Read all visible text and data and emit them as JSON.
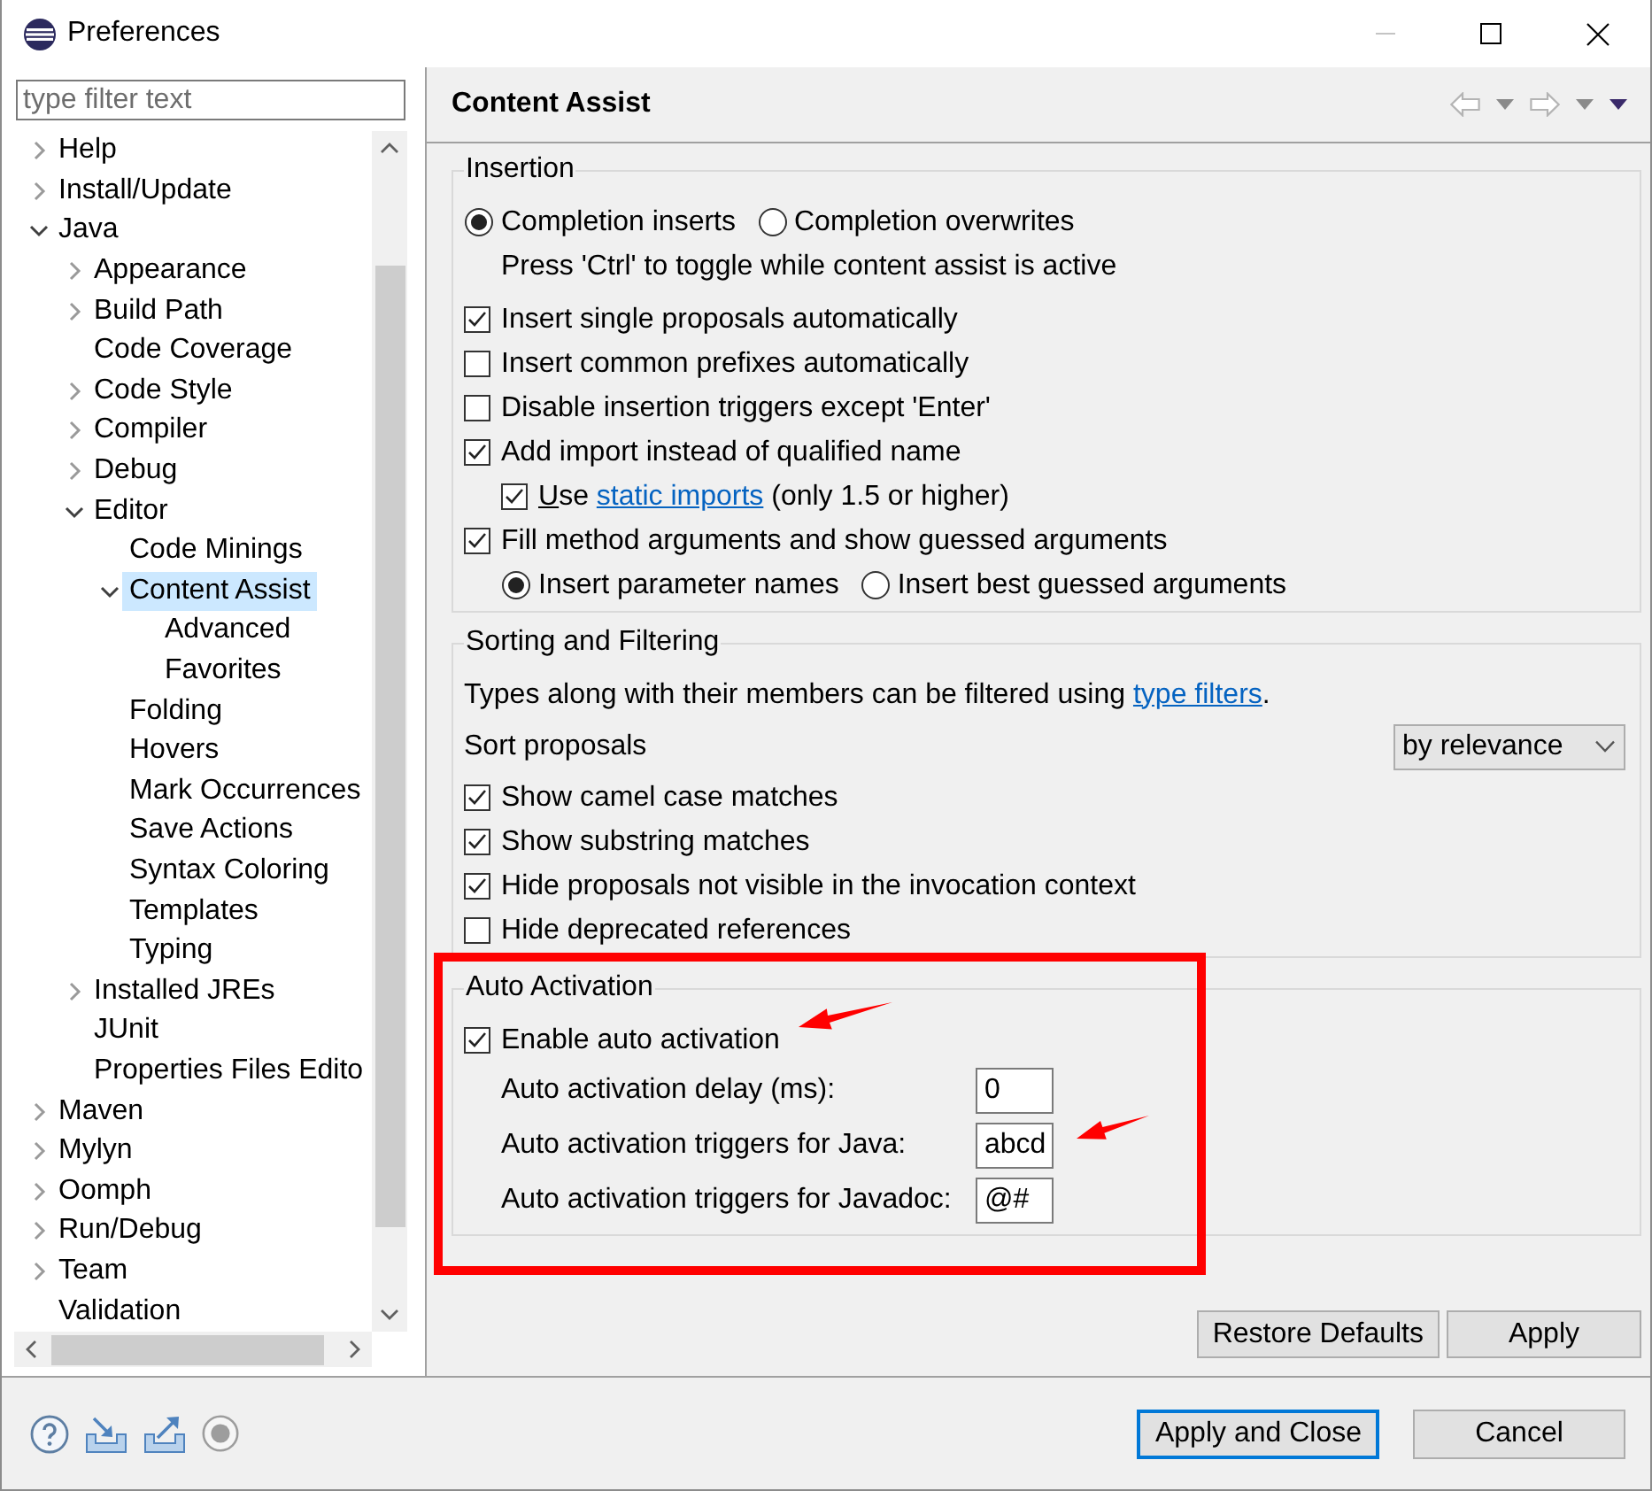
{
  "window": {
    "title": "Preferences",
    "minimize_enabled": false
  },
  "filter": {
    "placeholder": "type filter text"
  },
  "tree": [
    {
      "label": "Help",
      "expanded": false,
      "selected": false
    },
    {
      "label": "Install/Update",
      "expanded": false,
      "selected": false
    },
    {
      "label": "Java",
      "expanded": true,
      "selected": false,
      "children": [
        {
          "label": "Appearance",
          "expanded": false,
          "selected": false
        },
        {
          "label": "Build Path",
          "expanded": false,
          "selected": false
        },
        {
          "label": "Code Coverage",
          "selected": false
        },
        {
          "label": "Code Style",
          "expanded": false,
          "selected": false
        },
        {
          "label": "Compiler",
          "expanded": false,
          "selected": false
        },
        {
          "label": "Debug",
          "expanded": false,
          "selected": false
        },
        {
          "label": "Editor",
          "expanded": true,
          "selected": false,
          "children": [
            {
              "label": "Code Minings",
              "selected": false
            },
            {
              "label": "Content Assist",
              "expanded": true,
              "selected": true,
              "children": [
                {
                  "label": "Advanced",
                  "selected": false
                },
                {
                  "label": "Favorites",
                  "selected": false
                }
              ]
            },
            {
              "label": "Folding",
              "selected": false
            },
            {
              "label": "Hovers",
              "selected": false
            },
            {
              "label": "Mark Occurrences",
              "selected": false
            },
            {
              "label": "Save Actions",
              "selected": false
            },
            {
              "label": "Syntax Coloring",
              "selected": false
            },
            {
              "label": "Templates",
              "selected": false
            },
            {
              "label": "Typing",
              "selected": false
            }
          ]
        },
        {
          "label": "Installed JREs",
          "expanded": false,
          "selected": false
        },
        {
          "label": "JUnit",
          "selected": false
        },
        {
          "label": "Properties Files Edito",
          "selected": false
        }
      ]
    },
    {
      "label": "Maven",
      "expanded": false,
      "selected": false
    },
    {
      "label": "Mylyn",
      "expanded": false,
      "selected": false
    },
    {
      "label": "Oomph",
      "expanded": false,
      "selected": false
    },
    {
      "label": "Run/Debug",
      "expanded": false,
      "selected": false
    },
    {
      "label": "Team",
      "expanded": false,
      "selected": false
    },
    {
      "label": "Validation",
      "selected": false
    }
  ],
  "page": {
    "title": "Content Assist",
    "back_enabled": false,
    "forward_enabled": false
  },
  "groups": [
    {
      "title": "Insertion",
      "rows": [
        {
          "kind": "radios",
          "options": [
            {
              "label": "Completion inserts",
              "selected": true
            },
            {
              "label": "Completion overwrites",
              "selected": false
            }
          ],
          "children": [
            {
              "kind": "note",
              "text": "Press 'Ctrl' to toggle while content assist is active"
            }
          ]
        },
        {
          "kind": "checkbox",
          "label": "Insert single proposals automatically",
          "checked": true
        },
        {
          "kind": "checkbox",
          "label": "Insert common prefixes automatically",
          "checked": false
        },
        {
          "kind": "checkbox",
          "label": "Disable insertion triggers except 'Enter'",
          "checked": false
        },
        {
          "kind": "checkbox",
          "label": "Add import instead of qualified name",
          "checked": true,
          "children": [
            {
              "kind": "checkbox",
              "label": "Use",
              "mnemonic": true,
              "link": "static imports",
              "suffix": " (only 1.5 or higher)",
              "checked": true
            }
          ]
        },
        {
          "kind": "checkbox",
          "label": "Fill method arguments and show guessed arguments",
          "checked": true,
          "children": [
            {
              "kind": "radios",
              "options": [
                {
                  "label": "Insert parameter names",
                  "selected": true
                },
                {
                  "label": "Insert best guessed arguments",
                  "selected": false
                }
              ]
            }
          ]
        }
      ]
    },
    {
      "title": "Sorting and Filtering",
      "rows": [
        {
          "kind": "note",
          "text": "Types along with their members can be filtered using",
          "link": "type filters",
          "suffix": "."
        },
        {
          "kind": "select",
          "label": "Sort proposals",
          "value": "by relevance"
        },
        {
          "kind": "checkbox",
          "label": "Show camel case matches",
          "checked": true
        },
        {
          "kind": "checkbox",
          "label": "Show substring matches",
          "checked": true
        },
        {
          "kind": "checkbox",
          "label": "Hide proposals not visible in the invocation context",
          "checked": true
        },
        {
          "kind": "checkbox",
          "label": "Hide deprecated references",
          "checked": false
        }
      ]
    },
    {
      "title": "Auto Activation",
      "rows": [
        {
          "kind": "checkbox",
          "label": "Enable auto activation",
          "checked": true,
          "children": [
            {
              "kind": "field",
              "label": "Auto activation delay (ms):",
              "value": "0"
            },
            {
              "kind": "field",
              "label": "Auto activation triggers for Java:",
              "value": "abcd"
            },
            {
              "kind": "field",
              "label": "Auto activation triggers for Javadoc:",
              "value": "@#"
            }
          ]
        }
      ]
    }
  ],
  "page_buttons": [
    {
      "label": "Restore Defaults"
    },
    {
      "label": "Apply"
    }
  ],
  "dialog_buttons": [
    {
      "label": "Apply and Close",
      "default": true
    },
    {
      "label": "Cancel",
      "default": false
    }
  ]
}
